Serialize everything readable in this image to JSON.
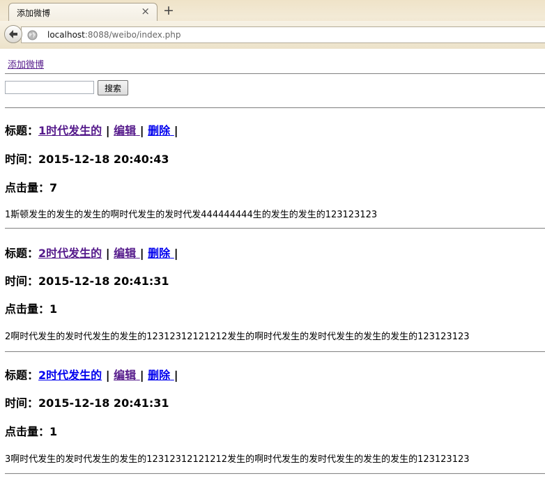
{
  "browser": {
    "tab_title": "添加微博",
    "tab_close": "×",
    "new_tab": "+",
    "url_host": "localhost",
    "url_rest": ":8088/weibo/index.php"
  },
  "page": {
    "add_link": "添加微博",
    "search": {
      "value": "",
      "button_label": "搜索"
    },
    "labels": {
      "title": "标题：",
      "time": "时间：",
      "clicks": "点击量：",
      "edit": "编辑",
      "delete": "删除",
      "sep": "|"
    },
    "posts": [
      {
        "title": "1时代发生的",
        "time": "2015-12-18 20:40:43",
        "clicks": "7",
        "content": "1斯顿发生的发生的发生的啊时代发生的发时代发444444444生的发生的发生的123123123"
      },
      {
        "title": "2时代发生的",
        "time": "2015-12-18 20:41:31",
        "clicks": "1",
        "content": "2啊时代发生的发时代发生的发生的12312312121212发生的啊时代发生的发时代发生的发生的发生的123123123"
      },
      {
        "title": "2时代发生的",
        "time": "2015-12-18 20:41:31",
        "clicks": "1",
        "content": "3啊时代发生的发时代发生的发生的12312312121212发生的啊时代发生的发时代发生的发生的发生的123123123"
      }
    ]
  },
  "colors": {
    "visited_link": "#551a8b",
    "link": "#0000ee"
  }
}
